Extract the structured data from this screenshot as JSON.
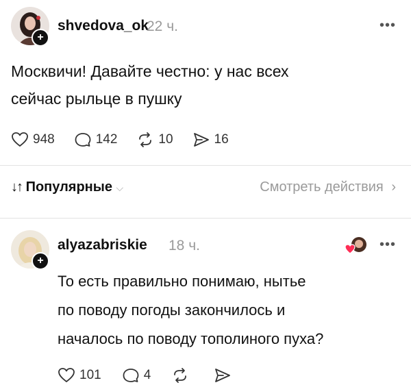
{
  "post": {
    "username": "shvedova_ok",
    "time": "22 ч.",
    "text_line1": "Москвичи! Давайте честно: у нас всех",
    "text_line2": "сейчас рыльце в пушку",
    "likes": "948",
    "comments": "142",
    "reposts": "10",
    "shares": "16"
  },
  "sortbar": {
    "sort_label": "Популярные",
    "view_actions": "Смотреть действия"
  },
  "reply": {
    "username": "alyazabriskie",
    "time": "18 ч.",
    "text_line1": "То есть правильно понимаю, нытье",
    "text_line2": "по поводу погоды закончилось и",
    "text_line3": "началось по поводу тополиного пуха?",
    "likes": "101",
    "comments": "4"
  },
  "icons": {
    "more": "more-icon",
    "like": "heart-icon",
    "comment": "comment-icon",
    "repost": "repost-icon",
    "share": "share-icon",
    "follow": "plus-icon"
  }
}
